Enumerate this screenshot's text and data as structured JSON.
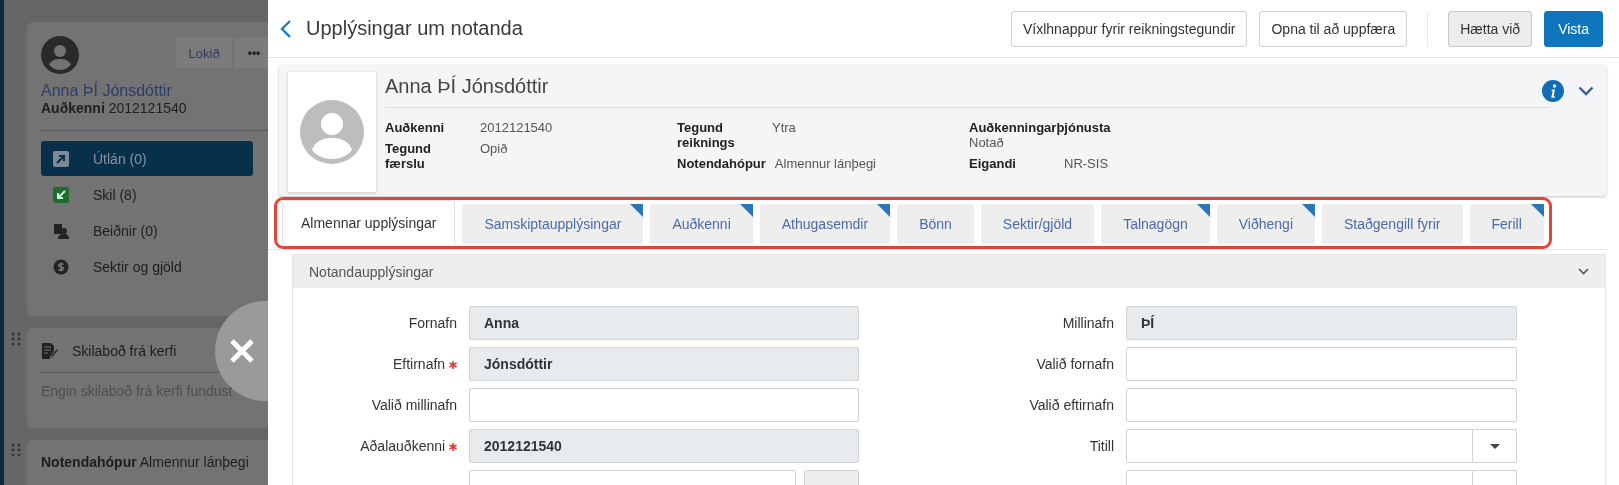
{
  "sidebar": {
    "user_card": {
      "done_button": "Lokið",
      "more_button": "•••",
      "name": "Anna ÞÍ Jónsdóttir",
      "id_label": "Auðkenni",
      "id_value": "2012121540",
      "nav": [
        {
          "kind": "loans",
          "label": "Útlán (0)",
          "selected": true
        },
        {
          "kind": "returns",
          "label": "Skil (8)",
          "selected": false
        },
        {
          "kind": "requests",
          "label": "Beiðnir (0)",
          "selected": false
        },
        {
          "kind": "fines",
          "label": "Sektir og gjöld",
          "selected": false
        }
      ]
    },
    "messages_card": {
      "title": "Skilaboð frá kerfi",
      "empty_text": "Engin skilaboð frá kerfi fundust"
    },
    "info_card": {
      "group_label": "Notendahópur",
      "group_value": "Almennur lánþegi"
    }
  },
  "header": {
    "title": "Upplýsingar um notanda",
    "buttons": [
      {
        "kind": "outline",
        "label": "Víxlhnappur fyrir reikningstegundir"
      },
      {
        "kind": "outline",
        "label": "Opna til að uppfæra"
      },
      {
        "kind": "secondary",
        "label": "Hætta við"
      },
      {
        "kind": "primary",
        "label": "Vista"
      }
    ]
  },
  "user_summary": {
    "name": "Anna ÞÍ Jónsdóttir",
    "columns": [
      [
        {
          "label": "Auðkenni",
          "value": "2012121540"
        },
        {
          "label": "Tegund færslu",
          "value": "Opið"
        }
      ],
      [
        {
          "label": "Tegund reiknings",
          "value": "Ytra"
        },
        {
          "label": "Notendahópur",
          "value": "Almennur lánþegi"
        }
      ],
      [
        {
          "label": "Auðkenningarþjónusta",
          "value": "Notað"
        },
        {
          "label": "Eigandi",
          "value": "NR-SIS"
        }
      ]
    ]
  },
  "tabs_highlighted": true,
  "tabs": [
    {
      "label": "Almennar upplýsingar",
      "selected": true,
      "has_content": false
    },
    {
      "label": "Samskiptaupplýsingar",
      "selected": false,
      "has_content": true
    },
    {
      "label": "Auðkenni",
      "selected": false,
      "has_content": true
    },
    {
      "label": "Athugasemdir",
      "selected": false,
      "has_content": true
    },
    {
      "label": "Bönn",
      "selected": false,
      "has_content": false
    },
    {
      "label": "Sektir/gjöld",
      "selected": false,
      "has_content": false
    },
    {
      "label": "Talnagögn",
      "selected": false,
      "has_content": true
    },
    {
      "label": "Viðhengi",
      "selected": false,
      "has_content": true
    },
    {
      "label": "Staðgengill fyrir",
      "selected": false,
      "has_content": false
    },
    {
      "label": "Ferill",
      "selected": false,
      "has_content": true
    }
  ],
  "section": {
    "title": "Notandaupplýsingar",
    "rows": [
      {
        "left": {
          "kind": "text",
          "label": "Fornafn",
          "required": false,
          "readonly": true,
          "value": "Anna"
        },
        "right": {
          "kind": "text",
          "label": "Millinafn",
          "required": false,
          "readonly": true,
          "value": "ÞÍ"
        }
      },
      {
        "left": {
          "kind": "text",
          "label": "Eftirnafn",
          "required": true,
          "readonly": true,
          "value": "Jónsdóttir"
        },
        "right": {
          "kind": "text",
          "label": "Valið fornafn",
          "required": false,
          "readonly": false
        }
      },
      {
        "left": {
          "kind": "text",
          "label": "Valið millinafn",
          "required": false,
          "readonly": false
        },
        "right": {
          "kind": "text",
          "label": "Valið eftirnafn",
          "required": false,
          "readonly": false
        }
      },
      {
        "left": {
          "kind": "text",
          "label": "Aðalauðkenni",
          "required": true,
          "readonly": true,
          "value": "2012121540"
        },
        "right": {
          "kind": "select",
          "label": "Titill",
          "required": false,
          "readonly": false
        }
      },
      {
        "left": {
          "kind": "input_button",
          "readonly": false
        },
        "right": {
          "kind": "select",
          "readonly": false
        }
      }
    ]
  }
}
